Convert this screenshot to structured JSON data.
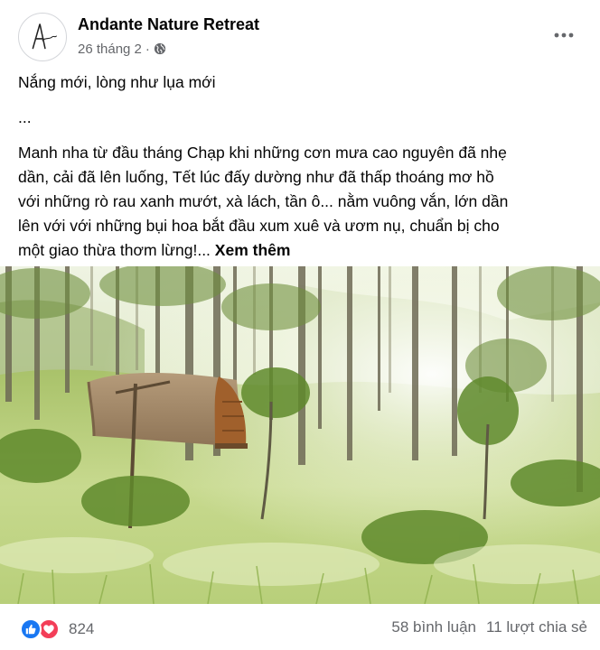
{
  "page": {
    "name": "Andante Nature Retreat",
    "avatar_text": "Andante"
  },
  "post": {
    "date": "26 tháng 2",
    "separator": "·",
    "privacy_icon": "globe-icon",
    "more_icon": "more-dots-icon",
    "headline": "Nắng mới, lòng như lụa mới",
    "ellipsis": "...",
    "body_lines": [
      "Manh nha từ đầu tháng Chạp khi những cơn mưa cao nguyên đã nhẹ",
      "dần, cải đã lên luống, Tết lúc đấy dường như đã thấp thoáng mơ hồ",
      "với những rò rau xanh mướt, xà lách, tần ô... nằm vuông vắn, lớn dần",
      "lên với với những bụi hoa bắt đầu xum xuê và ươm nụ, chuẩn bị cho",
      "một giao thừa thơm lừng!..."
    ],
    "see_more": "Xem thêm",
    "photo_icon": "photo-pine-forest-cabin"
  },
  "engagement": {
    "reaction_icons": [
      "like-icon",
      "love-icon"
    ],
    "reaction_count": "824",
    "comments": "58 bình luận",
    "shares": "11 lượt chia sẻ"
  },
  "colors": {
    "text": "#050505",
    "secondary": "#65676b",
    "like": "#1877f2",
    "love": "#f33e58"
  }
}
